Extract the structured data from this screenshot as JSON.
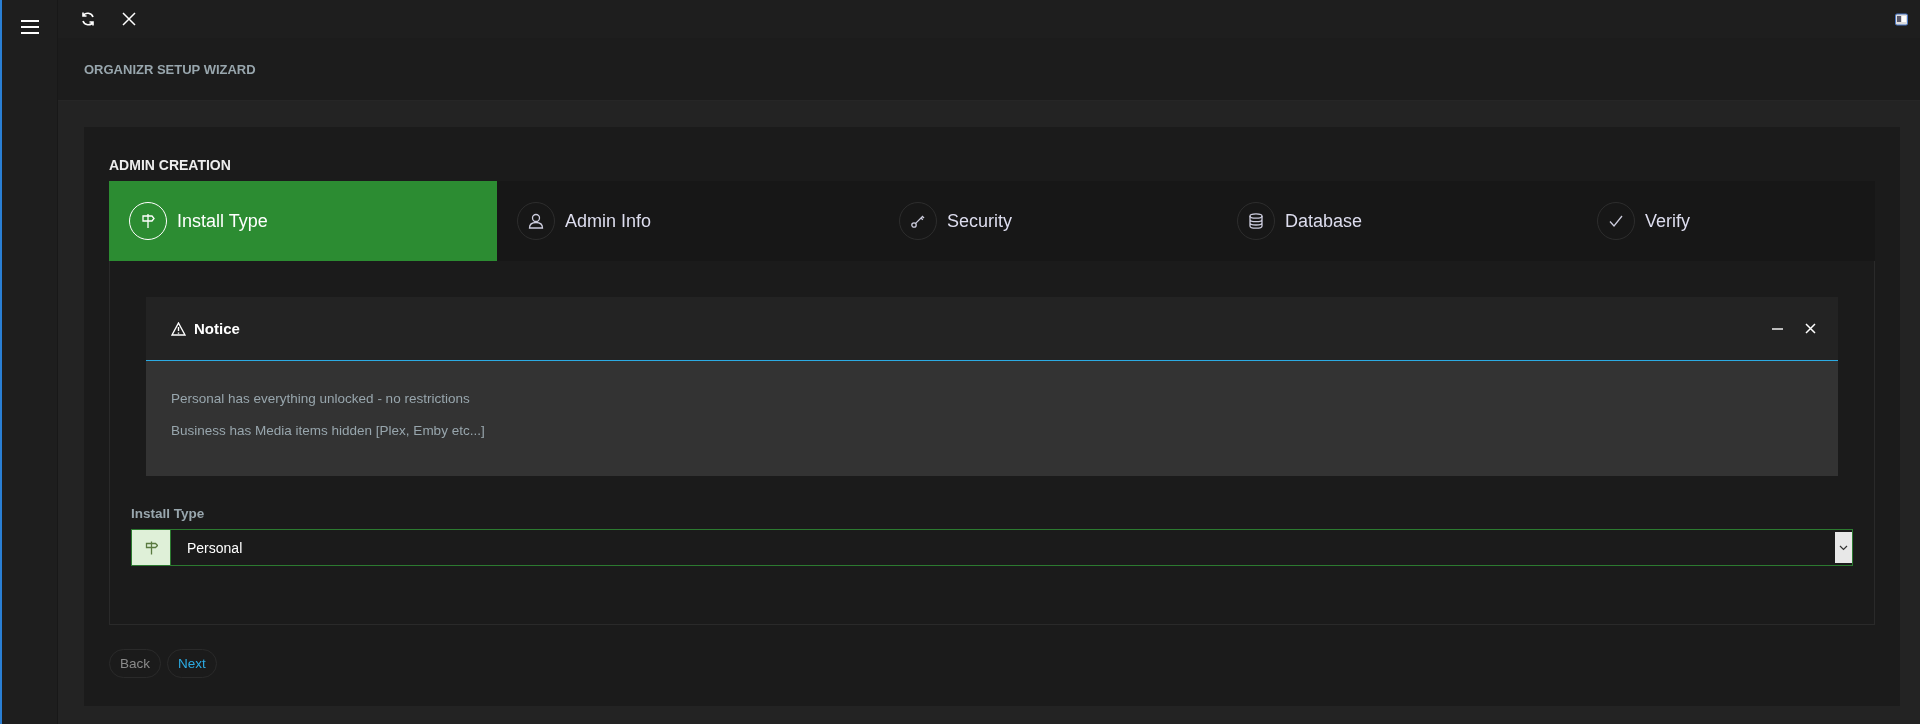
{
  "header": {
    "title": "ORGANIZR SETUP WIZARD"
  },
  "wizard": {
    "title": "ADMIN CREATION",
    "steps": [
      {
        "label": "Install Type",
        "selected": true
      },
      {
        "label": "Admin Info",
        "selected": false
      },
      {
        "label": "Security",
        "selected": false
      },
      {
        "label": "Database",
        "selected": false
      },
      {
        "label": "Verify",
        "selected": false
      }
    ]
  },
  "notice": {
    "title": "Notice",
    "lines": [
      "Personal has everything unlocked - no restrictions",
      "Business has Media items hidden [Plex, Emby etc...]"
    ]
  },
  "install_type": {
    "label": "Install Type",
    "value": "Personal"
  },
  "buttons": [
    {
      "label": "Back",
      "kind": "default"
    },
    {
      "label": "Next",
      "kind": "primary"
    }
  ]
}
